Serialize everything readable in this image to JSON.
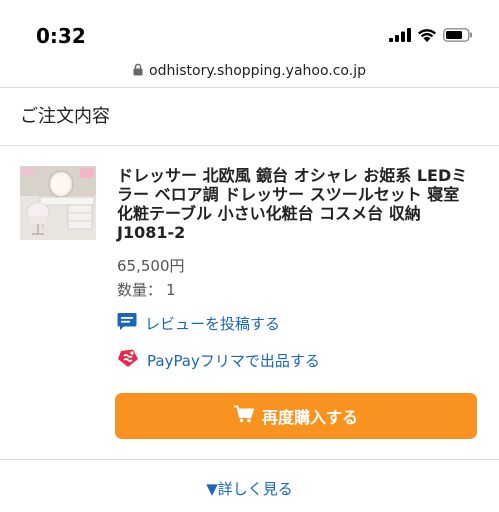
{
  "status_bar": {
    "time": "0:32"
  },
  "browser": {
    "url": "odhistory.shopping.yahoo.co.jp"
  },
  "page": {
    "section_title": "ご注文内容"
  },
  "order_item": {
    "name": "ドレッサー 北欧風 鏡台 オシャレ お姫系 LEDミラー ベロア調 ドレッサー スツールセット 寝室 化粧テーブル 小さい化粧台 コスメ台 収納 J1081-2",
    "price": "65,500円",
    "quantity_label": "数量：",
    "quantity_value": "1"
  },
  "actions": {
    "review_label": "レビューを投稿する",
    "paypay_label": "PayPayフリマで出品する",
    "rebuy_label": "再度購入する",
    "details_label": "▼詳しく見る"
  },
  "colors": {
    "accent_orange": "#f7931e",
    "link_blue": "#1a66b8",
    "paypay_red": "#e8294c"
  },
  "icons": {
    "lock": "lock-icon",
    "review": "speech-bubble-icon",
    "paypay": "paypay-flea-market-icon",
    "cart": "shopping-cart-icon"
  }
}
